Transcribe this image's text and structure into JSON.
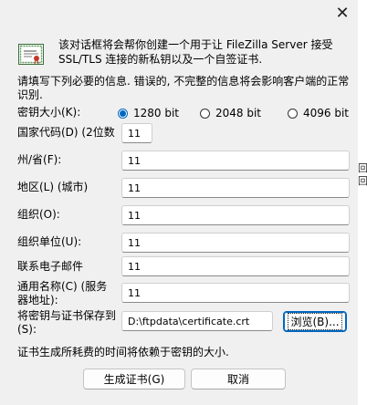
{
  "dialog": {
    "close_glyph": "✕",
    "intro_text": "该对话框将会帮你创建一个用于让 FileZilla Server 接受 SSL/TLS 连接的新私钥以及一个自签证书.",
    "instructions": "请填写下列必要的信息. 错误的, 不完整的信息将会影响客户端的正常识别.",
    "key_size": {
      "label": "密钥大小(K):",
      "options": [
        "1280 bit",
        "2048 bit",
        "4096 bit"
      ],
      "selected": "1280 bit"
    },
    "fields": {
      "country": {
        "label": "国家代码(D) (2位数",
        "value": "11"
      },
      "state": {
        "label": "州/省(F):",
        "value": "11"
      },
      "city": {
        "label": "地区(L) (城市)",
        "value": "11"
      },
      "org": {
        "label": "组织(O):",
        "value": "11"
      },
      "unit": {
        "label": "组织单位(U):",
        "value": "11"
      },
      "email": {
        "label": "联系电子邮件",
        "value": "11"
      },
      "common_name": {
        "label_line1": "通用名称(C) (服务",
        "label_line2": "器地址):",
        "value": "11"
      },
      "save_path": {
        "label_line1": "将密钥与证书保存到",
        "label_line2": "(S):",
        "value": "D:\\ftpdata\\certificate.crt"
      }
    },
    "browse_label": "浏览(B)...",
    "footer_note": "证书生成所耗费的时间将依赖于密钥的大小.",
    "generate_label": "生成证书(G)",
    "cancel_label": "取消"
  },
  "background_window": {
    "stubs": [
      "回",
      "回"
    ]
  },
  "colors": {
    "dialog_bg": "#f0f0f0",
    "accent": "#0067c0"
  },
  "icons": {
    "close": "close-icon",
    "certificate": "certificate-icon"
  }
}
